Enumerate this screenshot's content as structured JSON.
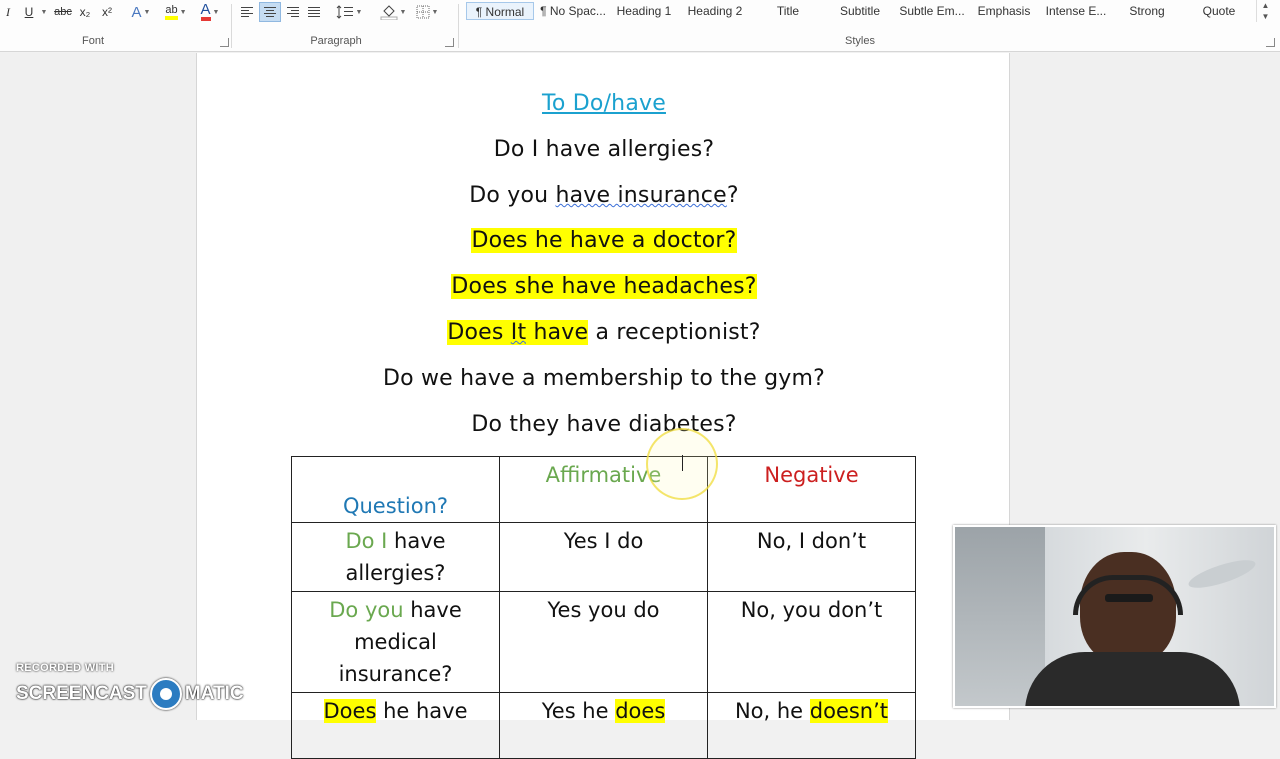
{
  "ribbon": {
    "font_group": {
      "label": "Font",
      "italic": "I",
      "underline": "U",
      "strike": "abc",
      "subscript": "x₂",
      "superscript": "x²",
      "text_effects": "A",
      "highlight": "ab",
      "font_color": "A"
    },
    "paragraph_group": {
      "label": "Paragraph"
    },
    "styles_group": {
      "label": "Styles",
      "items": [
        "¶ Normal",
        "¶ No Spac...",
        "Heading 1",
        "Heading 2",
        "Title",
        "Subtitle",
        "Subtle Em...",
        "Emphasis",
        "Intense E...",
        "Strong",
        "Quote"
      ],
      "active_index": 0
    },
    "colors": {
      "highlight": "#ffff00",
      "font_color": "#e53935"
    }
  },
  "document": {
    "title": "To Do/have",
    "lines": [
      {
        "segments": [
          {
            "text": "Do I have allergies?"
          }
        ]
      },
      {
        "segments": [
          {
            "text": "Do you "
          },
          {
            "text": "have  insurance",
            "squiggle": true
          },
          {
            "text": "?"
          }
        ]
      },
      {
        "segments": [
          {
            "text": "Does he have a doctor?",
            "hl": true
          }
        ]
      },
      {
        "segments": [
          {
            "text": "Does she have headaches?",
            "hl": true
          }
        ]
      },
      {
        "segments": [
          {
            "text": "Does ",
            "hl": true
          },
          {
            "text": "It",
            "hl": true,
            "squiggle": true
          },
          {
            "text": " have",
            "hl": true
          },
          {
            "text": " a receptionist?"
          }
        ]
      },
      {
        "segments": [
          {
            "text": "Do we have a membership to the gym?"
          }
        ]
      },
      {
        "segments": [
          {
            "text": "Do they have diabetes?"
          }
        ]
      }
    ],
    "table": {
      "headers": {
        "question": "Question?",
        "affirmative": "Affirmative",
        "negative": "Negative"
      },
      "rows": [
        {
          "q": [
            {
              "text": "Do I",
              "cls": "green"
            },
            {
              "text": " have allergies?"
            }
          ],
          "a": [
            {
              "text": "Yes I do"
            }
          ],
          "n": [
            {
              "text": "No, I don’t"
            }
          ]
        },
        {
          "q": [
            {
              "text": "Do you",
              "cls": "green"
            },
            {
              "text": " have medical insurance?"
            }
          ],
          "a": [
            {
              "text": "Yes you do"
            }
          ],
          "n": [
            {
              "text": "No, you don’t"
            }
          ]
        },
        {
          "q": [
            {
              "text": "Does",
              "cls": "hl"
            },
            {
              "text": " he have"
            }
          ],
          "a": [
            {
              "text": "Yes he "
            },
            {
              "text": "does",
              "cls": "hl"
            }
          ],
          "n": [
            {
              "text": "No, he "
            },
            {
              "text": "doesn’t",
              "cls": "hl"
            }
          ]
        }
      ]
    }
  },
  "watermark": {
    "top": "RECORDED WITH",
    "left": "SCREENCAST",
    "right": "MATIC"
  }
}
